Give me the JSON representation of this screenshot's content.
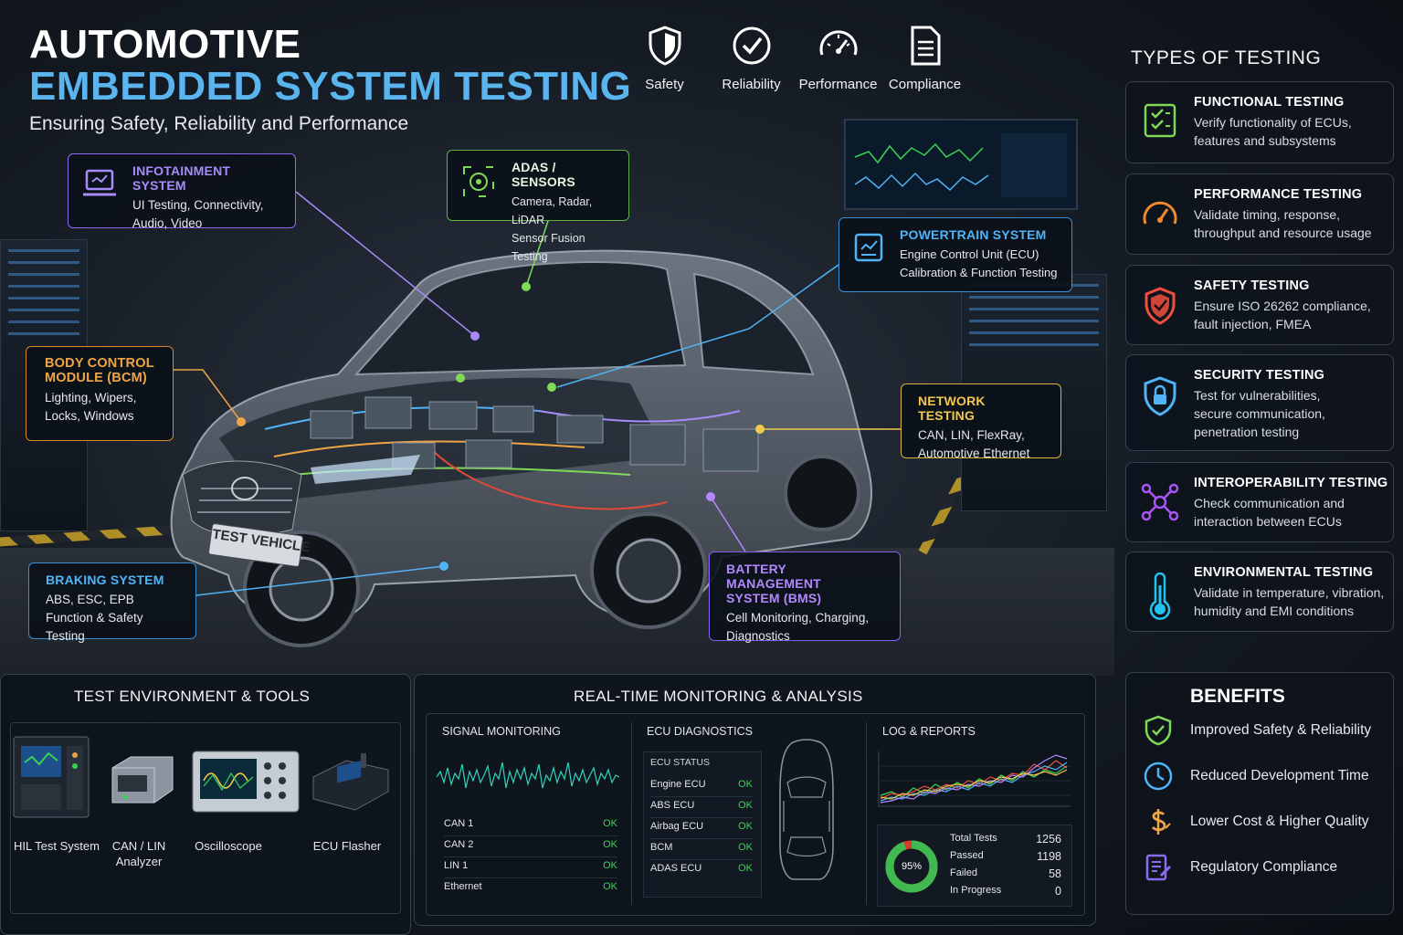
{
  "header": {
    "title_line1": "AUTOMOTIVE",
    "title_line2": "EMBEDDED SYSTEM TESTING",
    "subtitle": "Ensuring Safety, Reliability and Performance",
    "pillars": [
      {
        "label": "Safety",
        "icon": "shield-icon"
      },
      {
        "label": "Reliability",
        "icon": "check-circle-icon"
      },
      {
        "label": "Performance",
        "icon": "gauge-icon"
      },
      {
        "label": "Compliance",
        "icon": "document-icon"
      }
    ]
  },
  "vehicle": {
    "plate": "TEST VEHICLE"
  },
  "callouts": {
    "infotainment": {
      "title": "INFOTAINMENT SYSTEM",
      "line1": "UI Testing, Connectivity,",
      "line2": "Audio, Video",
      "color": "#a78bfa"
    },
    "adas": {
      "title": "ADAS / SENSORS",
      "line1": "Camera, Radar, LiDAR",
      "line2": "Sensor Fusion Testing",
      "color": "#7ed957"
    },
    "powertrain": {
      "title": "POWERTRAIN SYSTEM",
      "line1": "Engine Control Unit (ECU)",
      "line2": "Calibration & Function Testing",
      "color": "#4fb3f6"
    },
    "bcm": {
      "title_line1": "BODY CONTROL",
      "title_line2": "MODULE (BCM)",
      "line1": "Lighting, Wipers,",
      "line2": "Locks, Windows",
      "color": "#f0a545"
    },
    "network": {
      "title": "NETWORK TESTING",
      "line1": "CAN, LIN, FlexRay,",
      "line2": "Automotive Ethernet",
      "color": "#f2c94c"
    },
    "braking": {
      "title": "BRAKING SYSTEM",
      "line1": "ABS, ESC, EPB",
      "line2": "Function & Safety Testing",
      "color": "#4fb3f6"
    },
    "bms": {
      "title_line1": "BATTERY MANAGEMENT",
      "title_line2": "SYSTEM (BMS)",
      "line1": "Cell Monitoring, Charging,",
      "line2": "Diagnostics",
      "color": "#b388ff"
    }
  },
  "types_of_testing": {
    "title": "TYPES OF TESTING",
    "items": [
      {
        "title": "FUNCTIONAL TESTING",
        "line1": "Verify functionality of ECUs,",
        "line2": "features and subsystems",
        "line3": "",
        "icon": "checklist-icon",
        "color": "#7ed957"
      },
      {
        "title": "PERFORMANCE TESTING",
        "line1": "Validate timing, response,",
        "line2": "throughput and resource usage",
        "line3": "",
        "icon": "gauge-icon",
        "color": "#f08a2c"
      },
      {
        "title": "SAFETY TESTING",
        "line1": "Ensure ISO 26262 compliance,",
        "line2": "fault injection, FMEA",
        "line3": "",
        "icon": "shield-check-icon",
        "color": "#f04e3e"
      },
      {
        "title": "SECURITY TESTING",
        "line1": "Test for vulnerabilities,",
        "line2": "secure communication,",
        "line3": "penetration testing",
        "icon": "shield-lock-icon",
        "color": "#4fb3f6"
      },
      {
        "title": "INTEROPERABILITY TESTING",
        "line1": "Check communication and",
        "line2": "interaction between ECUs",
        "line3": "",
        "icon": "network-nodes-icon",
        "color": "#a855f7"
      },
      {
        "title": "ENVIRONMENTAL TESTING",
        "line1": "Validate in temperature, vibration,",
        "line2": "humidity and EMI conditions",
        "line3": "",
        "icon": "thermometer-icon",
        "color": "#22c1ee"
      }
    ]
  },
  "benefits": {
    "title": "BENEFITS",
    "items": [
      {
        "label": "Improved Safety & Reliability",
        "icon": "shield-check-icon",
        "color": "#7ed957"
      },
      {
        "label": "Reduced Development Time",
        "icon": "clock-icon",
        "color": "#4fb3f6"
      },
      {
        "label": "Lower Cost & Higher Quality",
        "icon": "dollar-icon",
        "color": "#f0a545"
      },
      {
        "label": "Regulatory Compliance",
        "icon": "compliance-doc-icon",
        "color": "#8b6cf0"
      }
    ]
  },
  "test_environment": {
    "title": "TEST ENVIRONMENT & TOOLS",
    "tools": [
      {
        "line1": "HIL Test System",
        "line2": ""
      },
      {
        "line1": "CAN / LIN",
        "line2": "Analyzer"
      },
      {
        "line1": "Oscilloscope",
        "line2": ""
      },
      {
        "line1": "ECU Flasher",
        "line2": ""
      }
    ]
  },
  "monitoring": {
    "title": "REAL-TIME MONITORING & ANALYSIS",
    "signal": {
      "title": "SIGNAL MONITORING",
      "rows": [
        {
          "name": "CAN 1",
          "status": "OK"
        },
        {
          "name": "CAN 2",
          "status": "OK"
        },
        {
          "name": "LIN 1",
          "status": "OK"
        },
        {
          "name": "Ethernet",
          "status": "OK"
        }
      ]
    },
    "ecu": {
      "title": "ECU DIAGNOSTICS",
      "status_header": "ECU STATUS",
      "rows": [
        {
          "name": "Engine ECU",
          "status": "OK"
        },
        {
          "name": "ABS ECU",
          "status": "OK"
        },
        {
          "name": "Airbag ECU",
          "status": "OK"
        },
        {
          "name": "BCM",
          "status": "OK"
        },
        {
          "name": "ADAS ECU",
          "status": "OK"
        }
      ]
    },
    "logs": {
      "title": "LOG & REPORTS",
      "pass_rate": "95%",
      "pass_fraction": 0.95,
      "stats": [
        {
          "label": "Total Tests",
          "value": "1256"
        },
        {
          "label": "Passed",
          "value": "1198"
        },
        {
          "label": "Failed",
          "value": "58"
        },
        {
          "label": "In Progress",
          "value": "0"
        }
      ]
    }
  }
}
